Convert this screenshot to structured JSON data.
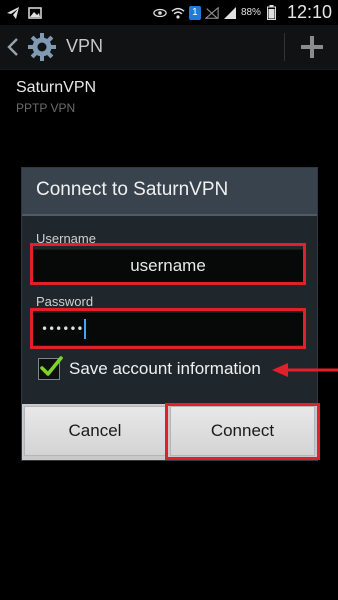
{
  "status_bar": {
    "badge": "1",
    "battery_pct": "88%",
    "time": "12:10",
    "icons": [
      "telegram-icon",
      "image-icon",
      "eye-icon",
      "wifi-icon",
      "sim-badge-icon",
      "no-signal-icon",
      "signal-icon",
      "battery-icon"
    ]
  },
  "action_bar": {
    "title": "VPN",
    "icons": [
      "back-chevron-icon",
      "gear-icon",
      "plus-icon"
    ]
  },
  "vpn_list": [
    {
      "name": "SaturnVPN",
      "type": "PPTP VPN"
    }
  ],
  "dialog": {
    "title": "Connect to SaturnVPN",
    "username_label": "Username",
    "username_value": "username",
    "password_label": "Password",
    "password_value": "••••••",
    "save_checked": true,
    "save_label": "Save account information",
    "cancel_label": "Cancel",
    "connect_label": "Connect"
  },
  "annotation": {
    "color": "#e0202a"
  },
  "colors": {
    "checkmark": "#7fd12b",
    "cursor": "#3ea6ff"
  }
}
